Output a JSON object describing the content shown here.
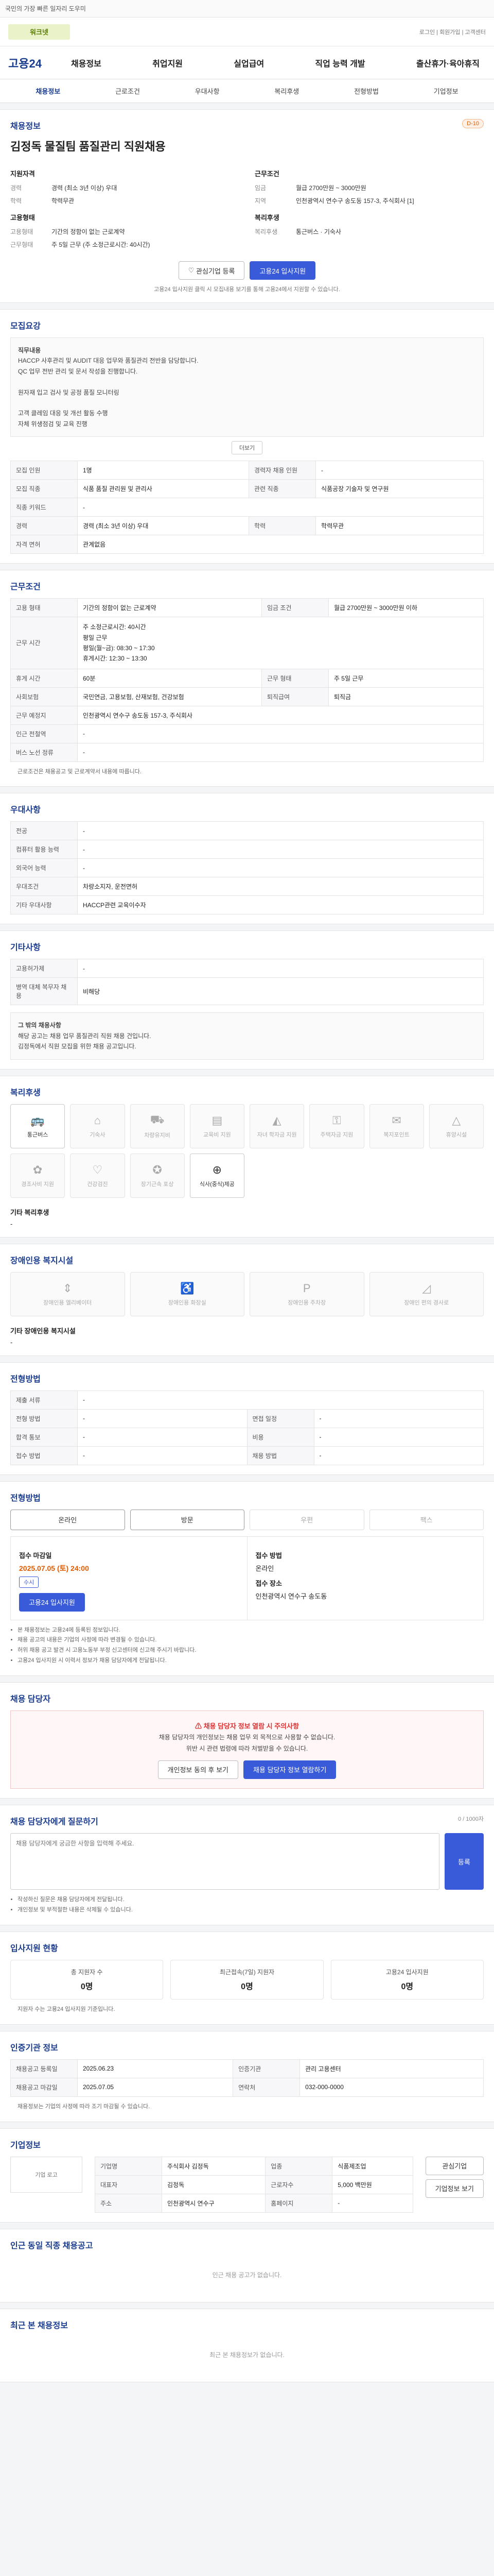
{
  "topbar": {
    "notice": "국민의 가장 빠른 일자리 도우미"
  },
  "logo_row": {
    "logo_text": "워크넷",
    "links": "로그인 | 회원가입 | 고객센터"
  },
  "header": {
    "brand": "고용24",
    "menu": [
      "채용정보",
      "취업지원",
      "실업급여",
      "직업 능력 개발",
      "출산휴가·육아휴직"
    ]
  },
  "subnav": [
    "채용정보",
    "근로조건",
    "우대사항",
    "복리후생",
    "전형방법",
    "기업정보"
  ],
  "summary": {
    "label": "채용정보",
    "badge": "D-10",
    "title": "김정독 물질팀 품질관리 직원채용",
    "left_head": "지원자격",
    "left": [
      {
        "k": "경력",
        "v": "경력 (최소 3년 이상) 우대"
      },
      {
        "k": "학력",
        "v": "학력무관"
      }
    ],
    "left_head2": "고용형태",
    "left2": [
      {
        "k": "고용형태",
        "v": "기간의 정함이 없는 근로계약"
      },
      {
        "k": "근무형태",
        "v": "주 5일 근무 (주 소정근로시간: 40시간)"
      }
    ],
    "right_head": "근무조건",
    "right": [
      {
        "k": "임금",
        "v": "월급 2700만원 ~ 3000만원"
      },
      {
        "k": "지역",
        "v": "인천광역시 연수구 송도동 157-3, 주식회사 [1]"
      }
    ],
    "right_head2": "복리후생",
    "right2": [
      {
        "k": "복리후생",
        "v": "통근버스 · 기숙사"
      }
    ],
    "btn_fav": "관심기업 등록",
    "btn_apply": "고용24 입사지원",
    "note": "고용24 입사지원 클릭 시 모집내용 보기를 통해 고용24에서 지원할 수 있습니다."
  },
  "recruit": {
    "title": "모집요강",
    "desc_head": "직무내용",
    "desc": "HACCP 사후관리 및 AUDIT 대응 업무와 품질관리 전반을 담당합니다.\nQC 업무 전반 관리 및 문서 작성을 진행합니다.\n\n원자재 입고 검사 및 공정 품질 모니터링\n\n고객 클레임 대응 및 개선 활동 수행\n자체 위생점검 및 교육 진행",
    "more": "더보기",
    "rows": [
      [
        "모집 인원",
        "1명",
        "경력자 채용 인원",
        "-"
      ],
      [
        "모집 직종",
        "식품 품질 관리원 및 관리사",
        "관련 직종",
        "식품공장 기술자 및 연구원"
      ],
      [
        "직종 키워드",
        "-",
        "",
        ""
      ],
      [
        "경력",
        "경력 (최소 3년 이상) 우대",
        "학력",
        "학력무관"
      ],
      [
        "자격 면허",
        "관계없음",
        "",
        ""
      ]
    ]
  },
  "conditions": {
    "title": "근무조건",
    "rows": [
      [
        "고용 형태",
        "기간의 정함이 없는 근로계약",
        "임금 조건",
        "월급 2700만원 ~ 3000만원 이하"
      ],
      [
        "근무 시간",
        "주 소정근로시간: 40시간\n평일 근무\n평일(월~금): 08:30 ~ 17:30\n휴게시간: 12:30 ~ 13:30",
        "",
        ""
      ],
      [
        "휴게 시간",
        "60분",
        "근무 형태",
        "주 5일 근무"
      ],
      [
        "사회보험",
        "국민연금, 고용보험, 산재보험, 건강보험",
        "퇴직급여",
        "퇴직금"
      ],
      [
        "근무 예정지",
        "인천광역시 연수구 송도동 157-3, 주식회사",
        "",
        ""
      ],
      [
        "인근 전철역",
        "-",
        "",
        ""
      ],
      [
        "버스 노선 정류",
        "-",
        "",
        ""
      ]
    ],
    "note": "근로조건은 채용공고 및 근로계약서 내용에 따릅니다."
  },
  "preference": {
    "title": "우대사항",
    "rows": [
      [
        "전공",
        "-"
      ],
      [
        "컴퓨터 활용 능력",
        "-"
      ],
      [
        "외국어 능력",
        "-"
      ],
      [
        "우대조건",
        "차량소지자, 운전면허"
      ],
      [
        "기타 우대사항",
        "HACCP관련 교육이수자"
      ]
    ]
  },
  "other": {
    "title": "기타사항",
    "rows": [
      [
        "고용허가제",
        "-"
      ],
      [
        "병역 대체 복무자 채용",
        "비해당"
      ]
    ],
    "sub_head": "그 밖의 채용사항",
    "sub_text": "해당 공고는 채용 업무 품질관리 직원 채용 건입니다.\n김정독에서 직원 모집을 위한 채용 공고입니다."
  },
  "welfare": {
    "title": "복리후생",
    "items": [
      {
        "label": "통근버스",
        "icon": "bus-icon",
        "on": true
      },
      {
        "label": "기숙사",
        "icon": "house-icon",
        "on": false
      },
      {
        "label": "차량유지비",
        "icon": "car-icon",
        "on": false
      },
      {
        "label": "교육비 지원",
        "icon": "book-icon",
        "on": false
      },
      {
        "label": "자녀 학자금 지원",
        "icon": "cap-icon",
        "on": false
      },
      {
        "label": "주택자금 지원",
        "icon": "key-icon",
        "on": false
      },
      {
        "label": "복지포인트",
        "icon": "gift-icon",
        "on": false
      },
      {
        "label": "휴양시설",
        "icon": "tent-icon",
        "on": false
      },
      {
        "label": "경조사비 지원",
        "icon": "flower-icon",
        "on": false
      },
      {
        "label": "건강검진",
        "icon": "heart-icon",
        "on": false
      },
      {
        "label": "장기근속 포상",
        "icon": "medal-icon",
        "on": false
      },
      {
        "label": "식사(중식)제공",
        "icon": "meal-icon",
        "on": true
      }
    ],
    "etc_head": "기타 복리후생",
    "etc_text": "-"
  },
  "disabled": {
    "title": "장애인용 복지시설",
    "items": [
      {
        "label": "장애인용 엘리베이터",
        "icon": "elevator-icon"
      },
      {
        "label": "장애인용 화장실",
        "icon": "toilet-icon"
      },
      {
        "label": "장애인용 주차장",
        "icon": "parking-icon"
      },
      {
        "label": "장애인 편의 경사로",
        "icon": "ramp-icon"
      }
    ],
    "etc_head": "기타 장애인용 복지시설",
    "etc_text": "-"
  },
  "selection": {
    "title": "전형방법",
    "rows": [
      [
        "제출 서류",
        "-",
        "",
        ""
      ],
      [
        "전형 방법",
        "-",
        "면접 일정",
        "-"
      ],
      [
        "합격 통보",
        "-",
        "비용",
        "-"
      ],
      [
        "접수 방법",
        "-",
        "채용 방법",
        "-"
      ]
    ]
  },
  "apply": {
    "title": "전형방법",
    "methods": [
      {
        "label": "온라인",
        "on": true
      },
      {
        "label": "방문",
        "on": true
      },
      {
        "label": "우편",
        "on": false
      },
      {
        "label": "팩스",
        "on": false
      }
    ],
    "deadline_head": "접수 마감일",
    "deadline": "2025.07.05 (토) 24:00",
    "chip": "수시",
    "apply_btn": "고용24 입사지원",
    "right_head": "접수 방법",
    "right_v1": "온라인",
    "right_head2": "접수 장소",
    "right_v2": "인천광역시 연수구 송도동"
  },
  "bullets": [
    "본 채용정보는 고용24에 등록된 정보입니다.",
    "채용 공고의 내용은 기업의 사정에 따라 변경될 수 있습니다.",
    "허위 채용 공고 발견 시 고용노동부 부정 신고센터에 신고해 주시기 바랍니다.",
    "고용24 입사지원 시 이력서 정보가 채용 담당자에게 전달됩니다."
  ],
  "manager": {
    "title": "채용 담당자",
    "warn_title": "채용 담당자 정보 열람 시 주의사항",
    "warn_text": "채용 담당자의 개인정보는 채용 업무 외 목적으로 사용할 수 없습니다.\n위반 시 관련 법령에 따라 처벌받을 수 있습니다.",
    "btn_view": "개인정보 동의 후 보기",
    "btn_contact": "채용 담당자 정보 열람하기"
  },
  "question": {
    "title": "채용 담당자에게 질문하기",
    "limit": "0 / 1000자",
    "placeholder": "채용 담당자에게 궁금한 사항을 입력해 주세요.",
    "submit": "등록",
    "notes": [
      "작성하신 질문은 채용 담당자에게 전달됩니다.",
      "개인정보 및 부적절한 내용은 삭제될 수 있습니다."
    ]
  },
  "stats": {
    "title": "입사지원 현황",
    "items": [
      {
        "label": "총 지원자 수",
        "value": "0명"
      },
      {
        "label": "최근접속(7일) 지원자",
        "value": "0명"
      },
      {
        "label": "고용24 입사지원",
        "value": "0명"
      }
    ],
    "note": "지원자 수는 고용24 입사지원 기준입니다."
  },
  "registration": {
    "title": "인증기관 정보",
    "rows": [
      [
        "채용공고 등록일",
        "2025.06.23",
        "인증기관",
        "관리 고용센터"
      ],
      [
        "채용공고 마감일",
        "2025.07.05",
        "연락처",
        "032-000-0000"
      ]
    ],
    "note": "채용정보는 기업의 사정에 따라 조기 마감될 수 있습니다."
  },
  "company": {
    "title": "기업정보",
    "logo_text": "기업 로고",
    "rows": [
      [
        "기업명",
        "주식회사 김정독",
        "업종",
        "식품제조업"
      ],
      [
        "대표자",
        "김정독",
        "근로자수",
        "5,000 백만원"
      ],
      [
        "주소",
        "인천광역시 연수구",
        "홈페이지",
        "-"
      ]
    ],
    "btn1": "관심기업",
    "btn2": "기업정보 보기"
  },
  "similar": {
    "title": "인근 동일 직종 채용공고",
    "empty": "인근 채용 공고가 없습니다."
  },
  "recent": {
    "title": "최근 본 채용정보",
    "empty": "최근 본 채용정보가 없습니다."
  }
}
